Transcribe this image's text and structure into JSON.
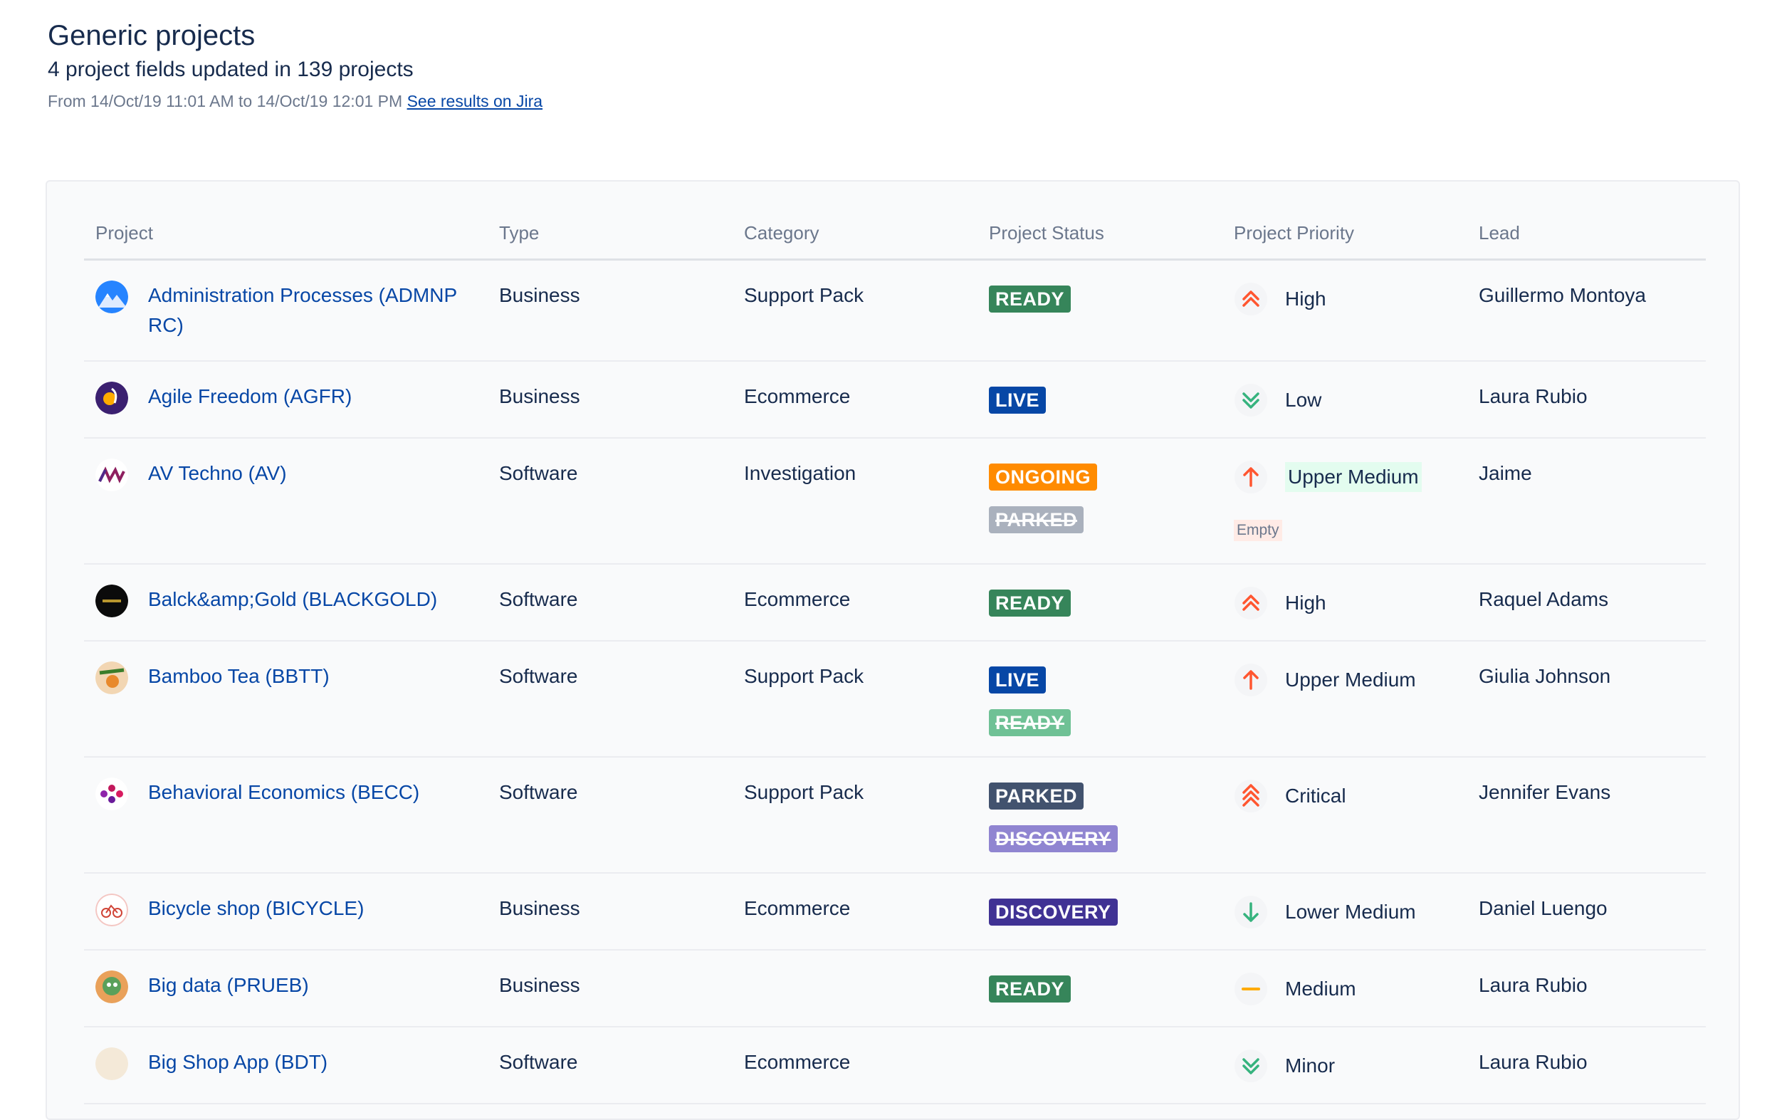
{
  "header": {
    "title": "Generic projects",
    "subtitle": "4 project fields updated in 139 projects",
    "range_text": "From 14/Oct/19 11:01 AM to 14/Oct/19 12:01 PM",
    "link_text": "See results on Jira"
  },
  "table": {
    "headers": [
      "Project",
      "Type",
      "Category",
      "Project Status",
      "Project Priority",
      "Lead"
    ],
    "rows": [
      {
        "project": "Administration Processes (ADMNP RC)",
        "avatar_icon": "mountain-icon",
        "type": "Business",
        "category": "Support Pack",
        "status": "READY",
        "status_color": "#36855a",
        "old_status": "",
        "old_status_color": "",
        "priority": "High",
        "priority_icon": "priority-high-icon",
        "priority_empty": "",
        "lead": "Guillermo Montoya"
      },
      {
        "project": "Agile Freedom (AGFR)",
        "avatar_icon": "agile-freedom-icon",
        "type": "Business",
        "category": "Ecommerce",
        "status": "LIVE",
        "status_color": "#0747a6",
        "old_status": "",
        "old_status_color": "",
        "priority": "Low",
        "priority_icon": "priority-low-icon",
        "priority_empty": "",
        "lead": "Laura Rubio"
      },
      {
        "project": "AV Techno (AV)",
        "avatar_icon": "av-techno-icon",
        "type": "Software",
        "category": "Investigation",
        "status": "ONGOING",
        "status_color": "#ff8b00",
        "old_status": "PARKED",
        "old_status_color": "#8993a4",
        "priority": "Upper Medium",
        "priority_icon": "priority-upper-medium-icon",
        "priority_empty": "Empty",
        "lead": "Jaime"
      },
      {
        "project": "Balck&amp;Gold (BLACKGOLD)",
        "avatar_icon": "black-gold-icon",
        "type": "Software",
        "category": "Ecommerce",
        "status": "READY",
        "status_color": "#36855a",
        "old_status": "",
        "old_status_color": "",
        "priority": "High",
        "priority_icon": "priority-high-icon",
        "priority_empty": "",
        "lead": "Raquel Adams"
      },
      {
        "project": "Bamboo Tea (BBTT)",
        "avatar_icon": "bamboo-tea-icon",
        "type": "Software",
        "category": "Support Pack",
        "status": "LIVE",
        "status_color": "#0747a6",
        "old_status": "READY",
        "old_status_color": "#36a96b",
        "priority": "Upper Medium",
        "priority_icon": "priority-upper-medium-icon",
        "priority_empty": "",
        "lead": "Giulia Johnson"
      },
      {
        "project": "Behavioral Economics (BECC)",
        "avatar_icon": "behavioral-economics-icon",
        "type": "Software",
        "category": "Support Pack",
        "status": "PARKED",
        "status_color": "#42526e",
        "old_status": "DISCOVERY",
        "old_status_color": "#6554c0",
        "priority": "Critical",
        "priority_icon": "priority-critical-icon",
        "priority_empty": "",
        "lead": "Jennifer Evans"
      },
      {
        "project": "Bicycle shop (BICYCLE)",
        "avatar_icon": "bicycle-icon",
        "type": "Business",
        "category": "Ecommerce",
        "status": "DISCOVERY",
        "status_color": "#403294",
        "old_status": "",
        "old_status_color": "",
        "priority": "Lower Medium",
        "priority_icon": "priority-lower-medium-icon",
        "priority_empty": "",
        "lead": "Daniel Luengo"
      },
      {
        "project": "Big data (PRUEB)",
        "avatar_icon": "big-data-icon",
        "type": "Business",
        "category": "",
        "status": "READY",
        "status_color": "#36855a",
        "old_status": "",
        "old_status_color": "",
        "priority": "Medium",
        "priority_icon": "priority-medium-icon",
        "priority_empty": "",
        "lead": "Laura Rubio"
      },
      {
        "project": "Big Shop App (BDT)",
        "avatar_icon": "big-shop-icon",
        "type": "Software",
        "category": "Ecommerce",
        "status": "",
        "status_color": "#de350b",
        "old_status": "",
        "old_status_color": "",
        "priority": "Minor",
        "priority_icon": "priority-low-icon",
        "priority_empty": "",
        "lead": "Laura Rubio"
      }
    ]
  }
}
